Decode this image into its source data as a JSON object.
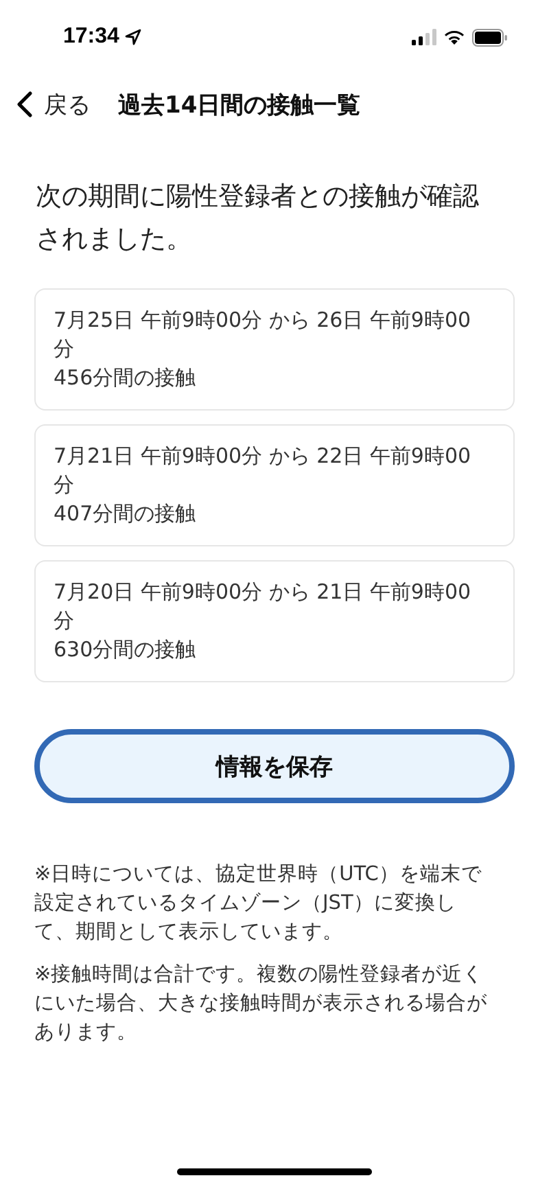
{
  "status_bar": {
    "time": "17:34"
  },
  "nav": {
    "back": "戻る",
    "title": "過去14日間の接触一覧"
  },
  "intro": "次の期間に陽性登録者との接触が確認されました。",
  "contacts": [
    {
      "period": "7月25日 午前9時00分 から 26日 午前9時00分",
      "duration": "456分間の接触"
    },
    {
      "period": "7月21日 午前9時00分 から 22日 午前9時00分",
      "duration": "407分間の接触"
    },
    {
      "period": "7月20日 午前9時00分 から 21日 午前9時00分",
      "duration": "630分間の接触"
    }
  ],
  "save_button": "情報を保存",
  "notes": [
    "※日時については、協定世界時（UTC）を端末で設定されているタイムゾーン（JST）に変換して、期間として表示しています。",
    "※接触時間は合計です。複数の陽性登録者が近くにいた場合、大きな接触時間が表示される場合があります。"
  ]
}
